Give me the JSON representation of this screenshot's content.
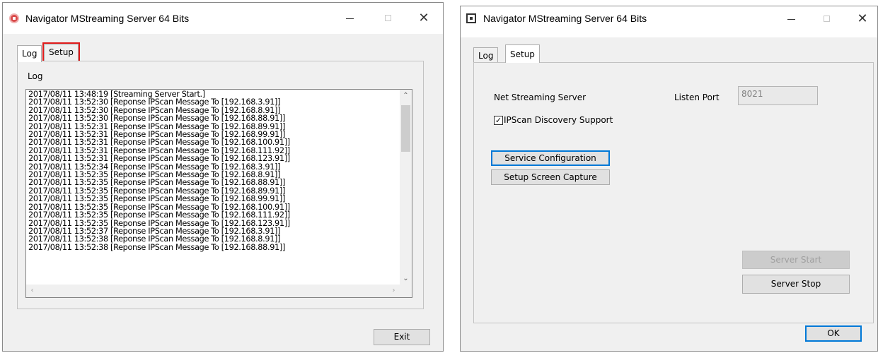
{
  "left_window": {
    "title": "Navigator MStreaming Server 64 Bits",
    "tabs": {
      "log": "Log",
      "setup": "Setup"
    },
    "group_label": "Log",
    "log_lines": [
      "2017/08/11 13:48:19 [Streaming Server Start.]",
      "2017/08/11 13:52:30 [Reponse IPScan Message To [192.168.3.91]]",
      "2017/08/11 13:52:30 [Reponse IPScan Message To [192.168.8.91]]",
      "2017/08/11 13:52:30 [Reponse IPScan Message To [192.168.88.91]]",
      "2017/08/11 13:52:31 [Reponse IPScan Message To [192.168.89.91]]",
      "2017/08/11 13:52:31 [Reponse IPScan Message To [192.168.99.91]]",
      "2017/08/11 13:52:31 [Reponse IPScan Message To [192.168.100.91]]",
      "2017/08/11 13:52:31 [Reponse IPScan Message To [192.168.111.92]]",
      "2017/08/11 13:52:31 [Reponse IPScan Message To [192.168.123.91]]",
      "2017/08/11 13:52:34 [Reponse IPScan Message To [192.168.3.91]]",
      "2017/08/11 13:52:35 [Reponse IPScan Message To [192.168.8.91]]",
      "2017/08/11 13:52:35 [Reponse IPScan Message To [192.168.88.91]]",
      "2017/08/11 13:52:35 [Reponse IPScan Message To [192.168.89.91]]",
      "2017/08/11 13:52:35 [Reponse IPScan Message To [192.168.99.91]]",
      "2017/08/11 13:52:35 [Reponse IPScan Message To [192.168.100.91]]",
      "2017/08/11 13:52:35 [Reponse IPScan Message To [192.168.111.92]]",
      "2017/08/11 13:52:35 [Reponse IPScan Message To [192.168.123.91]]",
      "2017/08/11 13:52:37 [Reponse IPScan Message To [192.168.3.91]]",
      "2017/08/11 13:52:38 [Reponse IPScan Message To [192.168.8.91]]",
      "2017/08/11 13:52:38 [Reponse IPScan Message To [192.168.88.91]]"
    ],
    "exit_label": "Exit",
    "highlight_color": "#e01b1b"
  },
  "right_window": {
    "title": "Navigator MStreaming Server 64 Bits",
    "tabs": {
      "log": "Log",
      "setup": "Setup"
    },
    "net_streaming_label": "Net Streaming Server",
    "listen_port_label": "Listen Port",
    "listen_port_value": "8021",
    "ipscan_label": "IPScan Discovery Support",
    "ipscan_checked": true,
    "service_config_label": "Service Configuration",
    "setup_capture_label": "Setup Screen Capture",
    "server_start_label": "Server Start",
    "server_stop_label": "Server Stop",
    "ok_label": "OK",
    "accent_color": "#0078d7"
  }
}
